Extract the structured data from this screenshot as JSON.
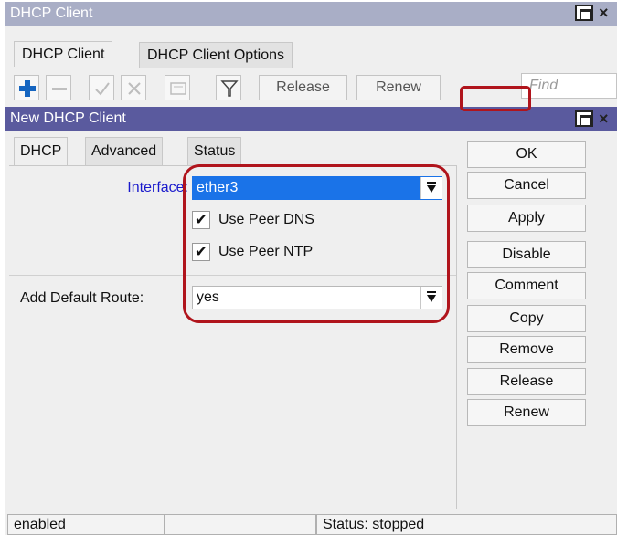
{
  "outer_window": {
    "title": "DHCP Client",
    "tabs": [
      "DHCP Client",
      "DHCP Client Options"
    ],
    "toolbar": {
      "icons": [
        "add-icon",
        "remove-icon",
        "enable-icon",
        "disable-icon",
        "comment-icon",
        "filter-icon"
      ],
      "release_label": "Release",
      "renew_label": "Renew",
      "find_placeholder": "Find"
    }
  },
  "dialog": {
    "title": "New DHCP Client",
    "tabs": [
      "DHCP",
      "Advanced",
      "Status"
    ],
    "fields": {
      "interface_label": "Interface:",
      "interface_value": "ether3",
      "use_peer_dns_label": "Use Peer DNS",
      "use_peer_dns_checked": true,
      "use_peer_ntp_label": "Use Peer NTP",
      "use_peer_ntp_checked": true,
      "add_default_route_label": "Add Default Route:",
      "add_default_route_value": "yes"
    },
    "buttons": [
      "OK",
      "Cancel",
      "Apply",
      "Disable",
      "Comment",
      "Copy",
      "Remove",
      "Release",
      "Renew"
    ],
    "status_bar": [
      "enabled",
      "",
      "Status: stopped"
    ]
  },
  "colors": {
    "annotation_red": "#b0141c",
    "dialog_title_bar": "#5a5a9e",
    "outer_title_bar": "#a9aec6",
    "selection_blue": "#1a73e8",
    "add_icon_blue": "#1565c0",
    "link_label_blue": "#1a1acc"
  }
}
